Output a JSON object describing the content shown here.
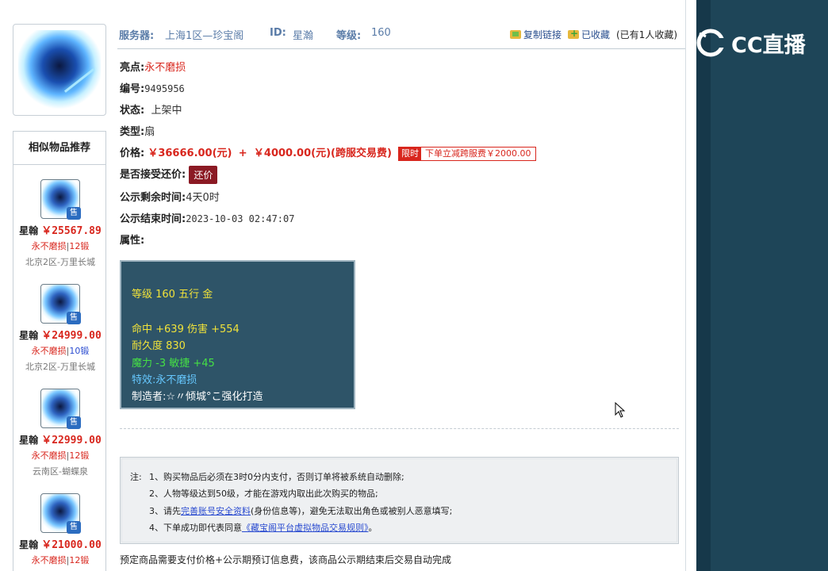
{
  "header": {
    "server_label": "服务器:",
    "server_value": "上海1区—珍宝阁",
    "id_label": "ID:",
    "id_value": "星瀚",
    "level_label": "等级:",
    "level_value": "160",
    "copy_link": "复制链接",
    "favorited": "已收藏",
    "fav_count": "(已有1人收藏)"
  },
  "details": {
    "highlight_label": "亮点:",
    "highlight_value": "永不磨损",
    "number_label": "编号:",
    "number_value": "9495956",
    "status_label": "状态:",
    "status_value": "上架中",
    "type_label": "类型:",
    "type_value": "扇",
    "price_label": "价格:",
    "price_value": "￥36666.00(元)",
    "plus": "+",
    "fee_value": "￥4000.00(元)(跨服交易费)",
    "limit_tag": "限时",
    "limit_desc": "下单立减跨服费￥2000.00",
    "counter_label": "是否接受还价:",
    "counter_button": "还价",
    "remain_label": "公示剩余时间:",
    "remain_value": "4天0时",
    "end_label": "公示结束时间:",
    "end_value": "2023-10-03 02:47:07",
    "attr_label": "属性:"
  },
  "attributes": {
    "line1": "等级 160 五行 金",
    "line2": "命中 +639 伤害 +554",
    "line3": "耐久度 830",
    "line4": "魔力 -3 敏捷 +45",
    "line5": "特效:永不磨损",
    "line6": "制造者:☆〃倾城°こ强化打造"
  },
  "sidebar": {
    "title": "相似物品推荐",
    "items": [
      {
        "name": "星翰",
        "price": "￥25567.89",
        "tag": "永不磨损",
        "level": "12锻",
        "level_color": "#d8261d",
        "server": "北京2区-万里长城",
        "sale": "售"
      },
      {
        "name": "星翰",
        "price": "￥24999.00",
        "tag": "永不磨损",
        "level": "10锻",
        "level_color": "#2a4bd0",
        "server": "北京2区-万里长城",
        "sale": "售"
      },
      {
        "name": "星翰",
        "price": "￥22999.00",
        "tag": "永不磨损",
        "level": "12锻",
        "level_color": "#d8261d",
        "server": "云南区-蝴蝶泉",
        "sale": "售"
      },
      {
        "name": "星翰",
        "price": "￥21000.00",
        "tag": "永不磨损",
        "level": "12锻",
        "level_color": "#d8261d",
        "server": "",
        "sale": "售"
      }
    ]
  },
  "notes": {
    "prefix": "注:",
    "n1": "1、购买物品后必须在3时0分内支付，否则订单将被系统自动删除;",
    "n2": "2、人物等级达到50级，才能在游戏内取出此次购买的物品;",
    "n3_pre": "3、请先",
    "n3_link": "完善账号安全资料",
    "n3_post": "(身份信息等)，避免无法取出角色或被别人恶意填写;",
    "n4_pre": "4、下单成功即代表同意",
    "n4_link": "《藏宝阁平台虚拟物品交易规则》",
    "n4_post": "。"
  },
  "footer": {
    "text": "预定商品需要支付价格+公示期预订信息费，该商品公示期结束后交易自动完成"
  },
  "brand": {
    "logo_text": "CC直播"
  }
}
